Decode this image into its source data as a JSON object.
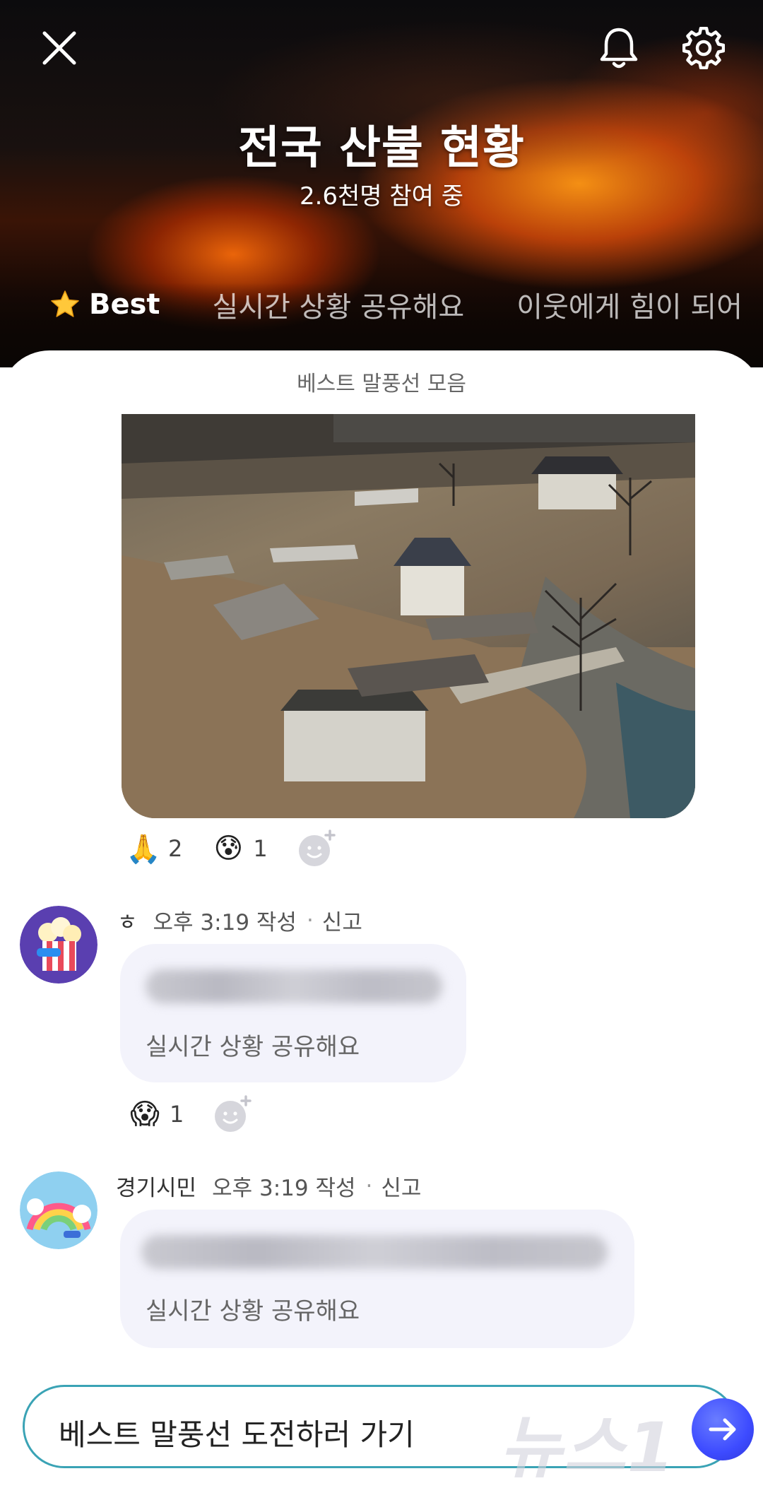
{
  "header": {
    "title": "전국 산불 현황",
    "participants": "2.6천명 참여 중",
    "tabs": [
      {
        "label": "Best",
        "icon": "star-icon",
        "active": true
      },
      {
        "label": "실시간 상황 공유해요",
        "active": false
      },
      {
        "label": "이웃에게 힘이 되어",
        "active": false
      }
    ]
  },
  "sheet": {
    "title": "베스트 말풍선 모음"
  },
  "photo_post": {
    "reactions": [
      {
        "emoji": "🙏",
        "icon": "praying-hands-icon",
        "count": "2"
      },
      {
        "emoji": "😰",
        "icon": "anxious-face-icon",
        "count": "1"
      }
    ]
  },
  "comments": [
    {
      "nickname": "ㅎ",
      "time": "오후 3:19 작성",
      "report": "신고",
      "tag": "실시간 상황 공유해요",
      "avatar": "popcorn-avatar",
      "reactions": [
        {
          "emoji": "😱",
          "icon": "screaming-face-icon",
          "count": "1"
        }
      ]
    },
    {
      "nickname": "경기시민",
      "time": "오후 3:19 작성",
      "report": "신고",
      "tag": "실시간 상황 공유해요",
      "avatar": "rainbow-avatar",
      "reactions": []
    }
  ],
  "cta": {
    "label": "베스트 말풍선 도전하러 가기"
  },
  "watermark": "뉴스1",
  "colors": {
    "accent_button": "#3d4bff",
    "cta_border": "#3aa3b5",
    "bubble_bg": "#f3f3fb"
  }
}
